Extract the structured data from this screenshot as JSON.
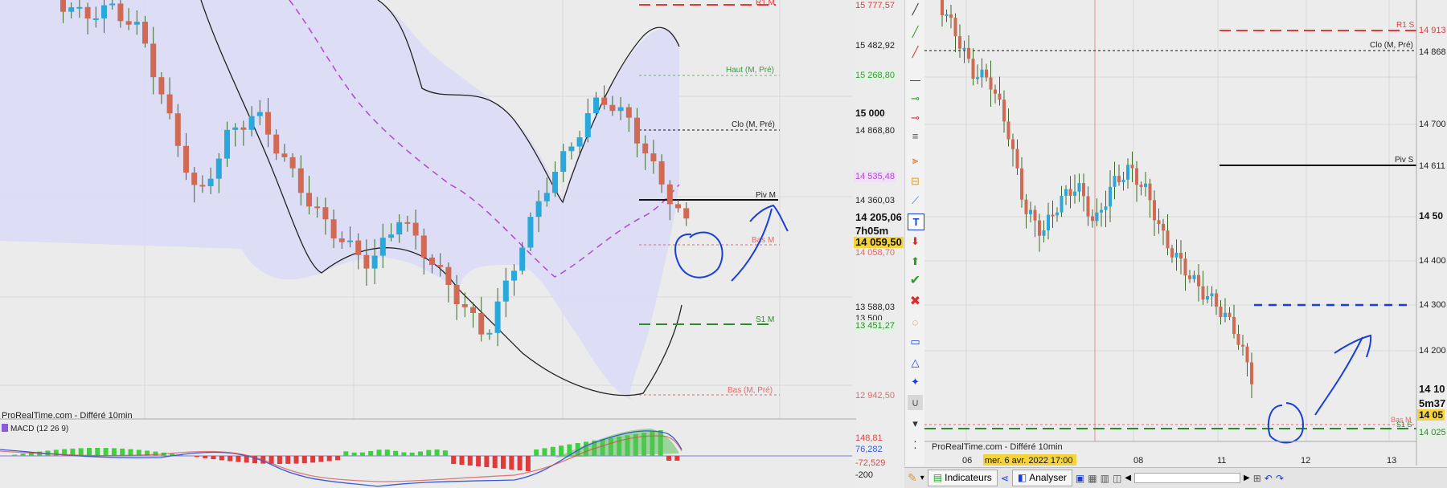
{
  "left_panel": {
    "source_label": "ProRealTime.com - Différé 10min",
    "macd_label": "MACD (12 26 9)",
    "level_labels": {
      "r1": "R1 M",
      "haut": "Haut (M, Pré)",
      "clo": "Clo (M, Pré)",
      "piv": "Piv M",
      "bas": "Bas M",
      "s1": "S1 M",
      "bas_pre": "Bas (M, Pré)"
    },
    "price_axis": {
      "ticks": [
        "15 482,92",
        "15 000",
        "14 360,03",
        "13 588,03",
        "13 500"
      ],
      "tags": {
        "r1": "15 777,57",
        "haut": "15 268,80",
        "clo": "14 868,80",
        "sma": "14 535,48",
        "last": "14 205,06",
        "timer": "7h05m",
        "bid": "14 059,50",
        "bas": "14 058,70",
        "s1": "13 451,27",
        "bas_pre": "12 942,50"
      }
    },
    "macd_axis": {
      "tags": [
        "148,81",
        "76,282",
        "-72,529"
      ],
      "tick": "-200"
    }
  },
  "right_panel": {
    "source_label": "ProRealTime.com - Différé 10min",
    "level_labels": {
      "r1": "R1 S",
      "clo": "Clo (M, Pré)",
      "piv": "Piv S",
      "bas": "Bas M",
      "s1": "S1 S"
    },
    "price_axis": {
      "ticks": [
        "14 700",
        "14 50",
        "14 400",
        "14 300",
        "14 200"
      ],
      "tags": {
        "r1": "14 913",
        "clo": "14 868",
        "piv": "14 611",
        "last": "14 10",
        "timer": "5m37",
        "bid": "14 05",
        "s1": "14 025"
      }
    },
    "time_axis": {
      "labels": [
        "06",
        "08",
        "11",
        "12",
        "13"
      ],
      "cursor_label": "mer. 6 avr. 2022 17:00"
    }
  },
  "bottom_toolbar": {
    "indicators_label": "Indicateurs",
    "analyse_label": "Analyser"
  },
  "colors": {
    "bull": "#29a8dc",
    "bear": "#d06a55",
    "resistance": "#e23b3b",
    "support": "#2d8a2d",
    "band_fill": "#dcdcf6",
    "pen": "#1a3fd8",
    "sma": "#b247d6"
  },
  "icons": [
    "line-tool-icon",
    "trend-up-icon",
    "trend-red-icon",
    "horizontal-line-icon",
    "arrow-down-icon",
    "arrow-up-icon",
    "check-icon",
    "cross-icon",
    "shape-icon",
    "text-icon",
    "fibonacci-icon",
    "magnet-icon",
    "pencil-icon",
    "share-icon"
  ]
}
